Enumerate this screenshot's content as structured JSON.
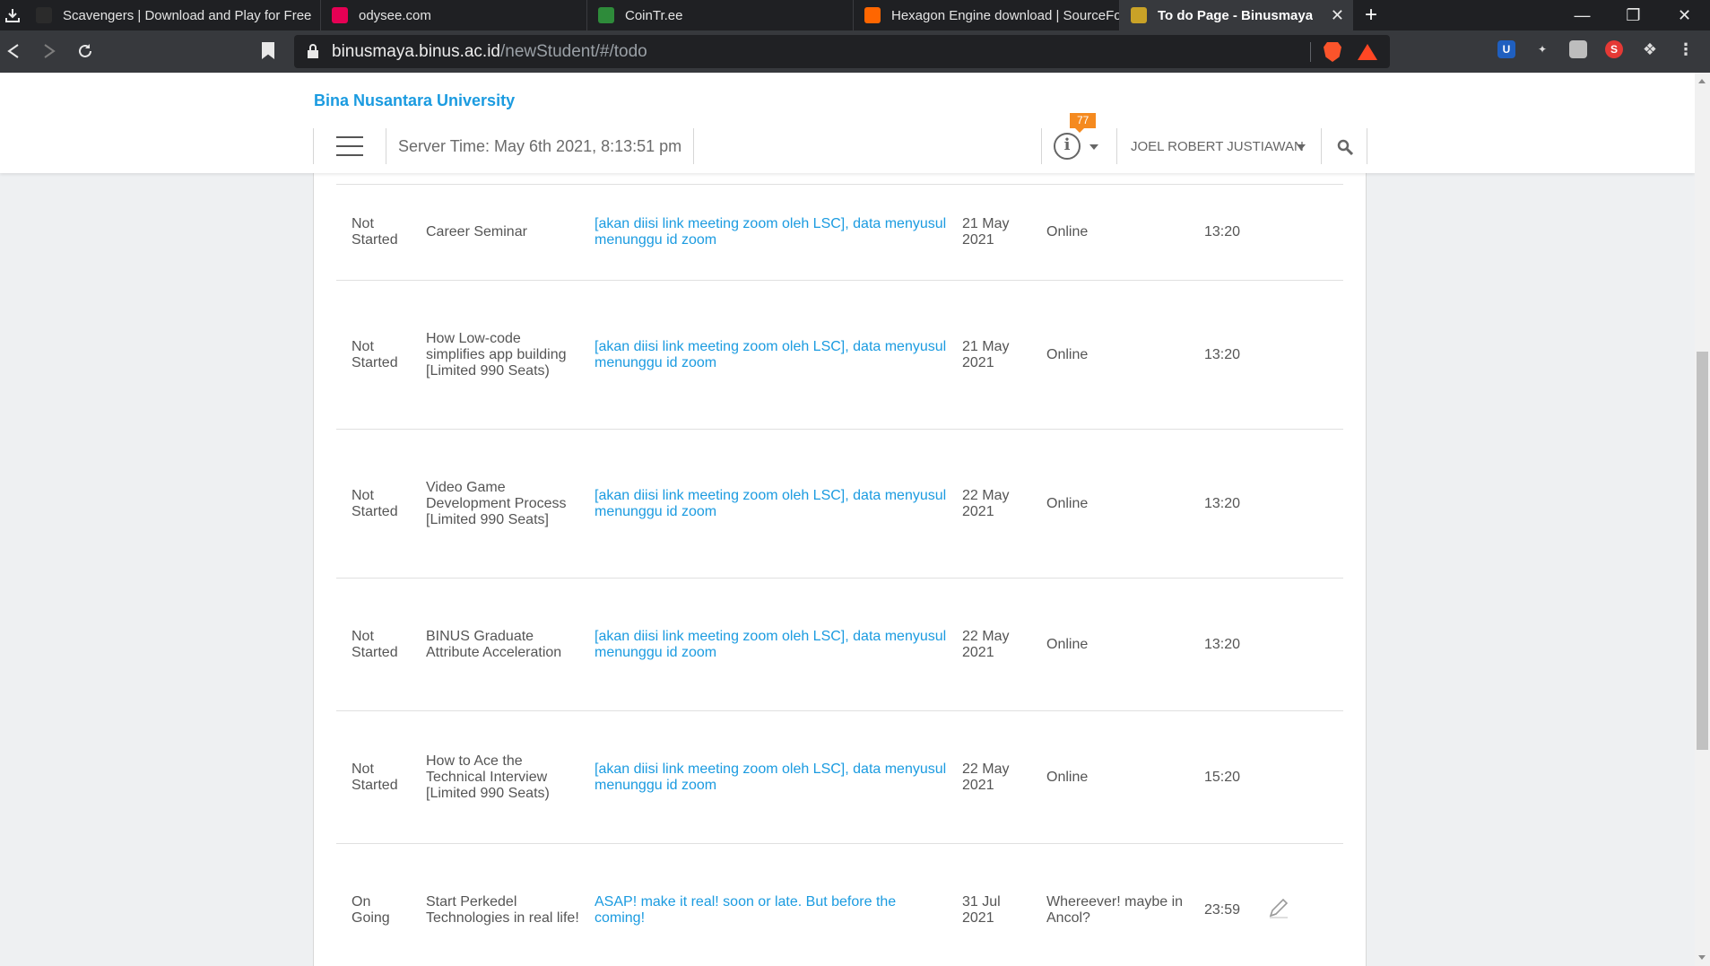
{
  "browser": {
    "tabs": [
      {
        "title": "Scavengers | Download and Play for Free",
        "favicon": "epic-games-icon",
        "color": "#2b2b2b",
        "active": false
      },
      {
        "title": "odysee.com",
        "favicon": "odysee-icon",
        "color": "#e50054",
        "active": false
      },
      {
        "title": "CoinTr.ee",
        "favicon": "tree-icon",
        "color": "#2e8b3a",
        "active": false
      },
      {
        "title": "Hexagon Engine download | SourceForge.net",
        "favicon": "sourceforge-icon",
        "color": "#ff6600",
        "active": false
      },
      {
        "title": "To do Page - Binusmaya",
        "favicon": "binus-icon",
        "color": "#c9a227",
        "active": true
      }
    ],
    "url_host": "binusmaya.binus.ac.id",
    "url_path": "/newStudent/#/todo"
  },
  "header": {
    "brand": "Bina Nusantara University",
    "server_time": "Server Time: May 6th 2021, 8:13:51 pm",
    "notification_count": "77",
    "user_name": "JOEL ROBERT JUSTIAWAN"
  },
  "todo": {
    "rows": [
      {
        "status": "Not Started",
        "title": "Career Seminar",
        "link": "[akan diisi link meeting zoom oleh LSC], data menyusul menunggu id zoom",
        "date": "21 May 2021",
        "location": "Online",
        "time": "13:20",
        "editable": false
      },
      {
        "status": "Not Started",
        "title": "How Low-code simplifies app building [Limited 990 Seats)",
        "link": "[akan diisi link meeting zoom oleh LSC], data menyusul menunggu id zoom",
        "date": "21 May 2021",
        "location": "Online",
        "time": "13:20",
        "editable": false
      },
      {
        "status": "Not Started",
        "title": "Video Game Development Process [Limited 990 Seats]",
        "link": "[akan diisi link meeting zoom oleh LSC], data menyusul menunggu id zoom",
        "date": "22 May 2021",
        "location": "Online",
        "time": "13:20",
        "editable": false
      },
      {
        "status": "Not Started",
        "title": "BINUS Graduate Attribute Acceleration",
        "link": "[akan diisi link meeting zoom oleh LSC], data menyusul menunggu id zoom",
        "date": "22 May 2021",
        "location": "Online",
        "time": "13:20",
        "editable": false
      },
      {
        "status": "Not Started",
        "title": "How to Ace the Technical Interview [Limited 990 Seats)",
        "link": "[akan diisi link meeting zoom oleh LSC], data menyusul menunggu id zoom",
        "date": "22 May 2021",
        "location": "Online",
        "time": "15:20",
        "editable": false
      },
      {
        "status": "On Going",
        "title": "Start Perkedel Technologies in real life!",
        "link": "ASAP! make it real! soon or late. But before the coming!",
        "date": "31 Jul 2021",
        "location": "Whereever! maybe in Ancol?",
        "time": "23:59",
        "editable": true
      }
    ]
  },
  "colors": {
    "accent": "#1b9be0",
    "badge": "#f58a1f"
  }
}
